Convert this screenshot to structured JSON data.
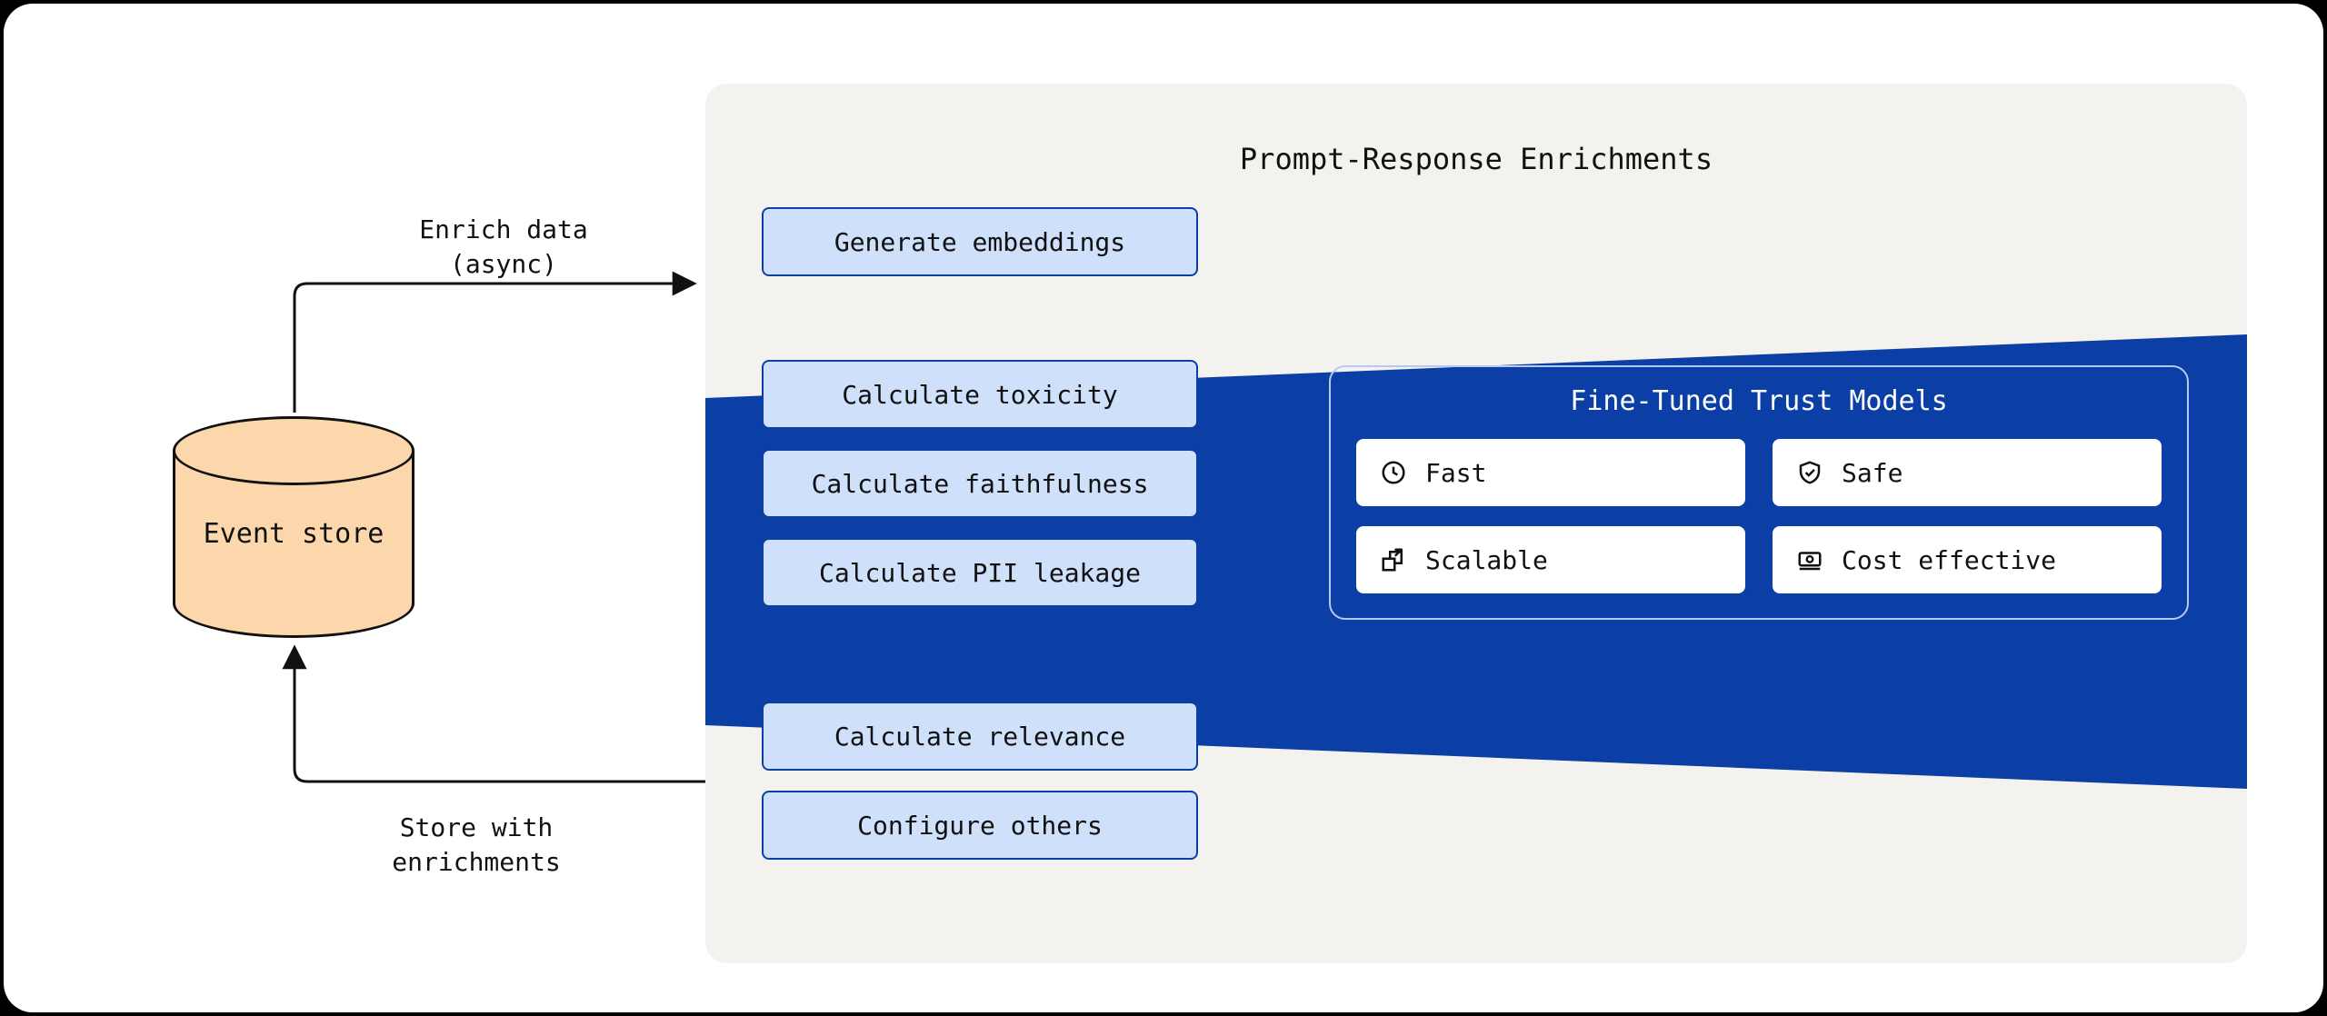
{
  "event_store": {
    "label": "Event store"
  },
  "arrows": {
    "to_panel": {
      "line1": "Enrich data",
      "line2": "(async)"
    },
    "from_panel": {
      "line1": "Store with",
      "line2": "enrichments"
    }
  },
  "panel": {
    "title": "Prompt-Response Enrichments",
    "enrichments": [
      "Generate embeddings",
      "Calculate toxicity",
      "Calculate faithfulness",
      "Calculate PII leakage",
      "Calculate relevance",
      "Configure others"
    ],
    "trust": {
      "title": "Fine-Tuned Trust Models",
      "items": [
        {
          "icon": "clock-icon",
          "label": "Fast"
        },
        {
          "icon": "shield-icon",
          "label": "Safe"
        },
        {
          "icon": "scale-icon",
          "label": "Scalable"
        },
        {
          "icon": "cost-icon",
          "label": "Cost effective"
        }
      ]
    }
  }
}
